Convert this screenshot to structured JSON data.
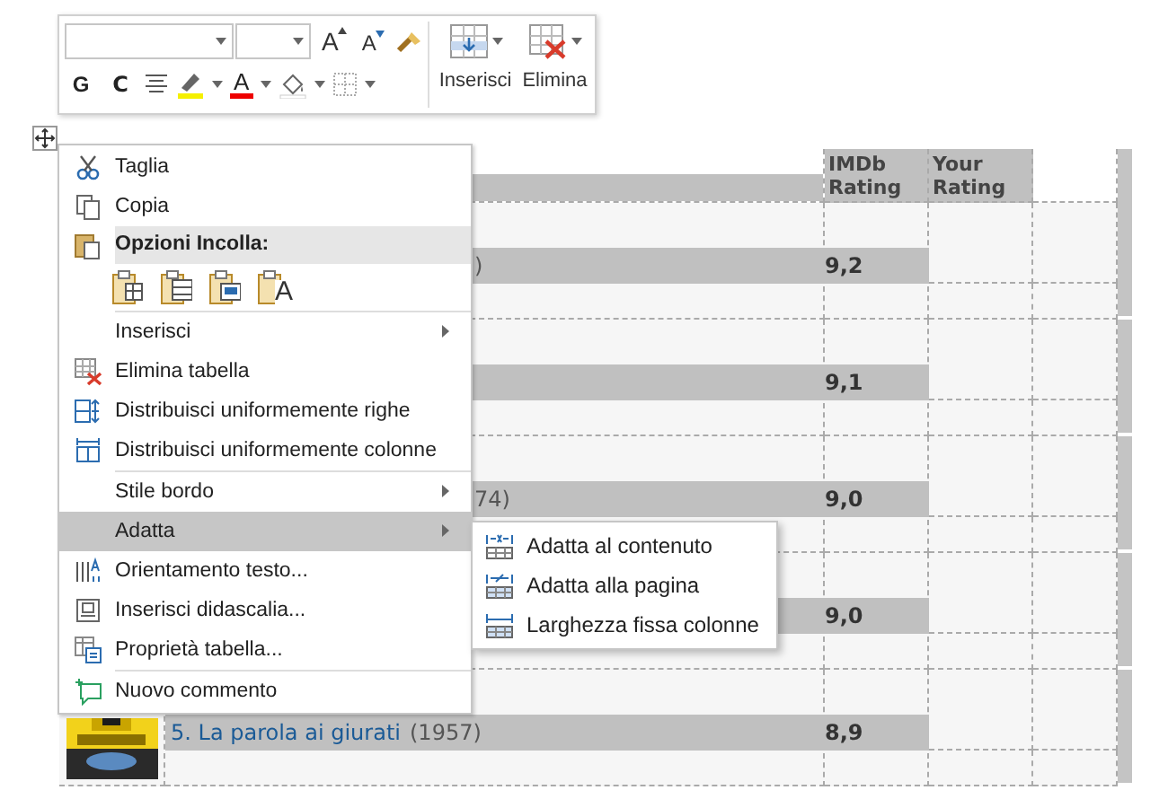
{
  "toolbar": {
    "grow_font": "A",
    "shrink_font": "A",
    "bold": "G",
    "italic": "C",
    "font_color": "A",
    "buttons": [
      {
        "label": "Inserisci"
      },
      {
        "label": "Elimina"
      }
    ]
  },
  "table": {
    "header": {
      "imdb": "IMDb Rating",
      "yours": "Your Rating"
    },
    "rows": [
      {
        "year": ")",
        "rating": "9,2"
      },
      {
        "rating": "9,1"
      },
      {
        "year": "74)",
        "rating": "9,0"
      },
      {
        "rating": "9,0"
      },
      {
        "title": "5. La parola ai giurati",
        "year": "(1957)",
        "rating": "8,9"
      }
    ]
  },
  "context_menu": {
    "items": [
      {
        "kind": "item",
        "label": "Taglia",
        "submenu": false,
        "selected": false
      },
      {
        "kind": "item",
        "label": "Copia",
        "submenu": false,
        "selected": false
      },
      {
        "kind": "header",
        "label": "Opzioni Incolla:"
      },
      {
        "kind": "paste",
        "options": [
          {
            "kind": "table"
          },
          {
            "kind": "merge"
          },
          {
            "kind": "nested"
          },
          {
            "kind": "text",
            "glyph": "A"
          }
        ]
      },
      {
        "kind": "separator"
      },
      {
        "kind": "item",
        "label": "Inserisci",
        "submenu": true,
        "selected": false
      },
      {
        "kind": "item",
        "label": "Elimina tabella",
        "submenu": false,
        "selected": false
      },
      {
        "kind": "item",
        "label": "Distribuisci uniformemente righe",
        "submenu": false,
        "selected": false
      },
      {
        "kind": "item",
        "label": "Distribuisci uniformemente colonne",
        "submenu": false,
        "selected": false
      },
      {
        "kind": "separator"
      },
      {
        "kind": "item",
        "label": "Stile bordo",
        "submenu": true,
        "selected": false
      },
      {
        "kind": "item",
        "label": "Adatta",
        "submenu": true,
        "selected": true
      },
      {
        "kind": "item",
        "label": "Orientamento testo...",
        "submenu": false,
        "selected": false
      },
      {
        "kind": "item",
        "label": "Inserisci didascalia...",
        "submenu": false,
        "selected": false
      },
      {
        "kind": "item",
        "label": "Proprietà tabella...",
        "submenu": false,
        "selected": false
      },
      {
        "kind": "separator"
      },
      {
        "kind": "item",
        "label": "Nuovo commento",
        "submenu": false,
        "selected": false
      }
    ]
  },
  "submenu": {
    "items": [
      {
        "label": "Adatta al contenuto"
      },
      {
        "label": "Adatta alla pagina"
      },
      {
        "label": "Larghezza fissa colonne"
      }
    ]
  }
}
